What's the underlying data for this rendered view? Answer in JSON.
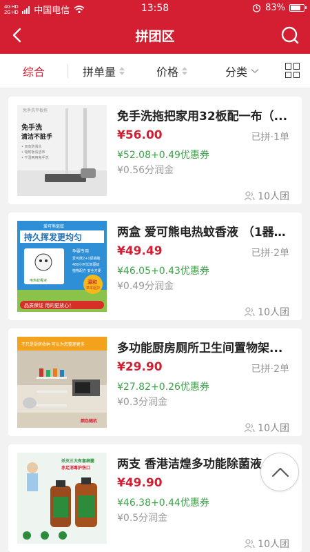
{
  "status_bar": {
    "signal": "4G HD\n2G HD",
    "carrier": "中国电信",
    "time": "13:58",
    "battery": "83%",
    "battery_level": 0.83
  },
  "nav": {
    "title": "拼团区",
    "back_icon": "chevron-left-icon",
    "search_icon": "search-icon"
  },
  "filters": {
    "items": [
      {
        "label": "综合",
        "active": true
      },
      {
        "label": "拼单量"
      },
      {
        "label": "价格"
      },
      {
        "label": "分类"
      }
    ],
    "grid_icon": "grid-view-icon"
  },
  "products": [
    {
      "title": "免手洗拖把家用32板配一布（...",
      "price": "¥56.00",
      "sold": "已拼·1单",
      "coupon": "¥52.08+0.49优惠券",
      "commission": "¥0.56分润金",
      "group": "10人团",
      "image_texts": [
        "免手洗",
        "清洁不脏手",
        "• 双向防滑水",
        "• 吸附板清洁布",
        "• 干湿两用免手洗",
        "免手洗平板拖"
      ]
    },
    {
      "title": "两盒 爱可熊电热蚊香液 （1器+...",
      "price": "¥49.49",
      "sold": "已拼·2单",
      "coupon": "¥46.05+0.43优惠券",
      "commission": "¥0.49分润金",
      "group": "10人团",
      "image_texts": [
        "爱可熊驱蚊",
        "持久挥发更均匀",
        "孕婴专用",
        "爱可熊2+1促销装",
        "480小时长效驱蚊",
        "植物配方 安全方便",
        "电热蚊香液",
        "温和",
        "草本驱护",
        "品质保证 用的更放心！"
      ]
    },
    {
      "title": "多功能厨房厕所卫生间置物架...",
      "price": "¥29.90",
      "sold": "已拼·2单",
      "coupon": "¥27.82+0.26优惠券",
      "commission": "¥0.3分润金",
      "group": "10人团",
      "image_texts": [
        "不只是厨房收纳 可以为您整理更多",
        "颜色随机"
      ]
    },
    {
      "title": "两支 香港洁煌多功能除菌液...",
      "price": "¥49.90",
      "sold": "",
      "coupon": "¥46.38+0.44优惠券",
      "commission": "¥0.5分润金",
      "group": "10人团",
      "image_texts": [
        "杀灭三大有害细菌",
        "赤足消毒护伤口"
      ]
    }
  ],
  "scroll_top_icon": "chevron-up-icon"
}
